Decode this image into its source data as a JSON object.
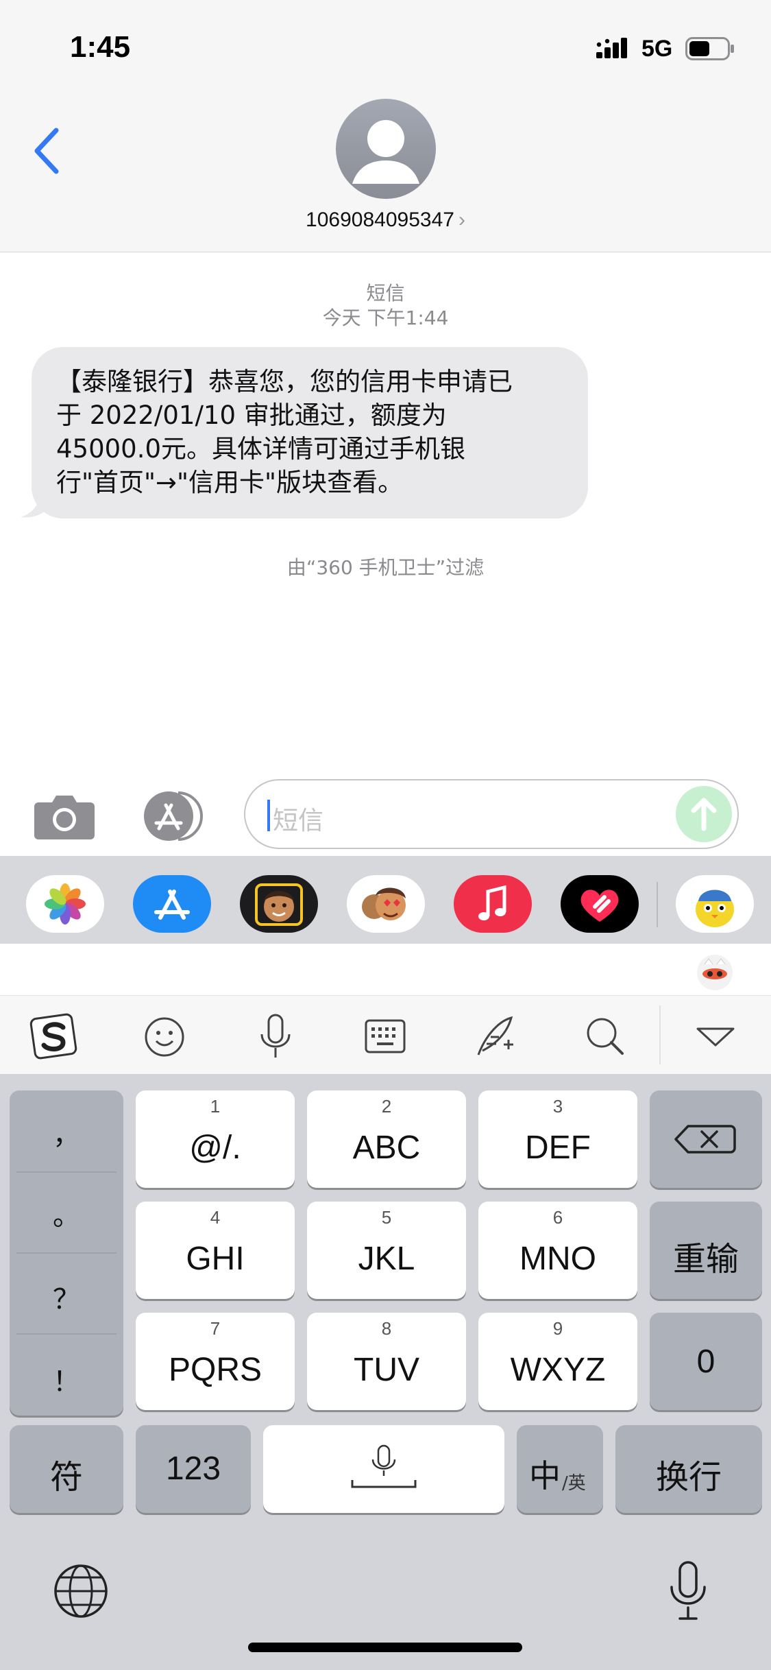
{
  "status_bar": {
    "time": "1:45",
    "network": "5G",
    "battery_level": 0.55
  },
  "header": {
    "contact": "1069084095347",
    "chevron": "›",
    "back_icon": "chevron-left-icon",
    "avatar_icon": "person-silhouette-icon"
  },
  "conversation": {
    "type_label": "短信",
    "timestamp": "今天 下午1:44",
    "messages": [
      {
        "lines": [
          "【泰隆银行】恭喜您，您的信用卡申请已",
          "于 2022/01/10 审批通过，额度为",
          "45000.0元。具体详情可通过手机银",
          "行\"首页\"→\"信用卡\"版块查看。"
        ]
      }
    ],
    "filter_note": "由“360 手机卫士”过滤"
  },
  "input": {
    "placeholder": "短信",
    "camera_icon": "camera-icon",
    "apps_icon": "app-store-icon",
    "send_icon": "send-arrow-icon"
  },
  "app_strip": [
    "photos-icon",
    "app-store-icon",
    "memoji-icon",
    "animoji-icon",
    "music-icon",
    "heart-digital-touch-icon",
    "sticker-bird-icon"
  ],
  "keyboard_toolbar": [
    "sogou-logo-icon",
    "emoji-icon",
    "microphone-icon",
    "keyboard-icon",
    "handwriting-icon",
    "search-icon",
    "collapse-icon"
  ],
  "keyboard": {
    "punctuation": [
      "，",
      "。",
      "？",
      "！"
    ],
    "keys": [
      {
        "num": "1",
        "label": "@/."
      },
      {
        "num": "2",
        "label": "ABC"
      },
      {
        "num": "3",
        "label": "DEF"
      },
      {
        "num": "4",
        "label": "GHI"
      },
      {
        "num": "5",
        "label": "JKL"
      },
      {
        "num": "6",
        "label": "MNO"
      },
      {
        "num": "7",
        "label": "PQRS"
      },
      {
        "num": "8",
        "label": "TUV"
      },
      {
        "num": "9",
        "label": "WXYZ"
      }
    ],
    "delete_icon": "backspace-icon",
    "retype": "重输",
    "zero": "0",
    "symbols": "符",
    "numbers": "123",
    "lang_main": "中",
    "lang_sub": "/英",
    "return": "换行",
    "globe_icon": "globe-icon",
    "mic_icon": "microphone-icon"
  }
}
